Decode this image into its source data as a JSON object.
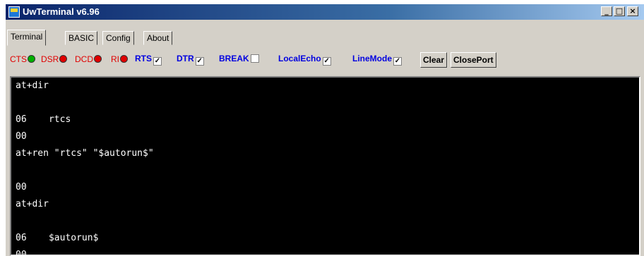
{
  "window": {
    "title": "UwTerminal v6.96",
    "controls": {
      "minimize": "_",
      "maximize": "□",
      "close": "×"
    }
  },
  "tabs": [
    {
      "label": "Terminal",
      "active": true
    },
    {
      "label": "BASIC",
      "active": false
    },
    {
      "label": "Config",
      "active": false
    },
    {
      "label": "About",
      "active": false
    }
  ],
  "indicators": [
    {
      "label": "CTS",
      "state_color": "#00b000"
    },
    {
      "label": "DSR",
      "state_color": "#e00000"
    },
    {
      "label": "DCD",
      "state_color": "#e00000"
    },
    {
      "label": "RI",
      "state_color": "#e00000"
    }
  ],
  "checkboxes": [
    {
      "label": "RTS",
      "checked": true
    },
    {
      "label": "DTR",
      "checked": true
    },
    {
      "label": "BREAK",
      "checked": false
    },
    {
      "label": "LocalEcho",
      "checked": true
    },
    {
      "label": "LineMode",
      "checked": true
    }
  ],
  "buttons": {
    "clear": "Clear",
    "close_port": "ClosePort"
  },
  "terminal": {
    "lines": [
      "at+dir",
      "",
      "06    rtcs",
      "00",
      "at+ren \"rtcs\" \"$autorun$\"",
      "",
      "00",
      "at+dir",
      "",
      "06    $autorun$",
      "00"
    ]
  }
}
